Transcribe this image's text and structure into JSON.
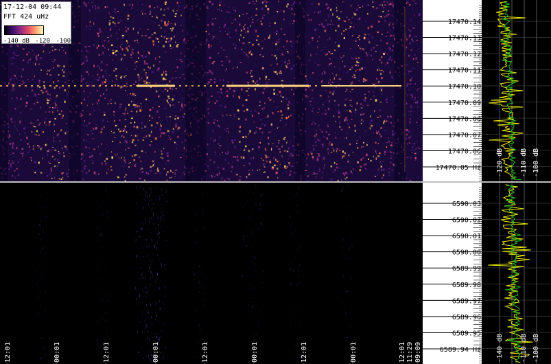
{
  "info": {
    "datetime": "17-12-04 09:44",
    "fft": "FFT 424 uHz",
    "colorbar_ticks": [
      "-140 dB",
      "-120",
      "-100"
    ]
  },
  "top_panel": {
    "freq_labels": [
      "17470.14",
      "17470.13",
      "17470.12",
      "17470.11",
      "17470.10",
      "17470.09",
      "17470.08",
      "17470.07",
      "17470.06",
      "17470.05 Hz"
    ],
    "db_labels": [
      "-120 dB",
      "-110 dB",
      "-100 dB"
    ]
  },
  "bottom_panel": {
    "freq_labels": [
      "6590.03",
      "6590.02",
      "6590.01",
      "6590.00",
      "6589.99",
      "6589.98",
      "6589.97",
      "6589.96",
      "6589.95",
      "6589.94 Hz"
    ],
    "db_labels": [
      "-140 dB",
      "-110 dB",
      "-100 dB"
    ]
  },
  "time_axis": {
    "labels": [
      "12:01",
      "00:01",
      "12:01",
      "00:01",
      "12:01",
      "00:01",
      "12:01",
      "00:01",
      "12:01",
      "11:29",
      "09:09"
    ]
  },
  "colors": {
    "background": "#000000",
    "spectrum_trace_a": "#f0f000",
    "spectrum_trace_b": "#20c020",
    "label_bg": "#ffffff"
  }
}
